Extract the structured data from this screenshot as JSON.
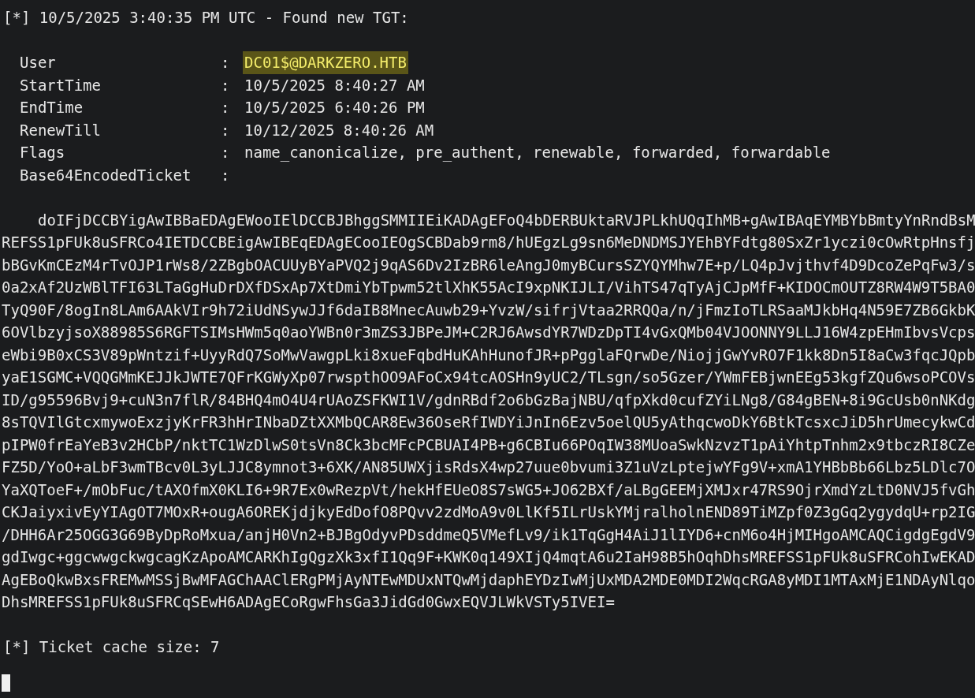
{
  "header": "[*] 10/5/2025 3:40:35 PM UTC - Found new TGT:",
  "fields": [
    {
      "key": "User",
      "separator": ":",
      "value": "DC01$@DARKZERO.HTB",
      "highlighted": true
    },
    {
      "key": "StartTime",
      "separator": ":",
      "value": "10/5/2025 8:40:27 AM",
      "highlighted": false
    },
    {
      "key": "EndTime",
      "separator": ":",
      "value": "10/5/2025 6:40:26 PM",
      "highlighted": false
    },
    {
      "key": "RenewTill",
      "separator": ":",
      "value": "10/12/2025 8:40:26 AM",
      "highlighted": false
    },
    {
      "key": "Flags",
      "separator": ":",
      "value": "name_canonicalize, pre_authent, renewable, forwarded, forwardable",
      "highlighted": false
    },
    {
      "key": "Base64EncodedTicket",
      "separator": ":"
    }
  ],
  "ticket_lines": [
    "doIFjDCCBYigAwIBBaEDAgEWooIElDCCBJBhggSMMIIEiKADAgEFoQ4bDERBUktaRVJPLkhUQqIhMB+gAwIBAqEYMBYbBmtyYnRndBsM",
    "REFSS1pFUk8uSFRCo4IETDCCBEigAwIBEqEDAgECooIEOgSCBDab9rm8/hUEgzLg9sn6MeDNDMSJYEhBYFdtg80SxZr1yczi0cOwRtpHnsfj",
    "bBGvKmCEzM4rTvOJP1rWs8/2ZBgbOACUUyBYaPVQ2j9qAS6Dv2IzBR6leAngJ0myBCursSZYQYMhw7E+p/LQ4pJvjthvf4D9DcoZePqFw3/s",
    "0a2xAf2UzWBlTFI63LTaGgHuDrDXfDSxAp7XtDmiYbTpwm52tlXhK55AcI9xpNKIJLI/VihTS47qTyAjCJpMfF+KIDOCmOUTZ8RW4W9T5BA0",
    "TyQ90F/8ogIn8LAm6AAkVIr9h72iUdNSywJJf6daIB8MnecAuwb29+YvzW/sifrjVtaa2RRQQa/n/jFmzIoTLRSaaMJkbHq4N59E7ZB6GkbK",
    "6OVlbzyjsoX88985S6RGFTSIMsHWm5q0aoYWBn0r3mZS3JBPeJM+C2RJ6AwsdYR7WDzDpTI4vGxQMb04VJOONNY9LLJ16W4zpEHmIbvsVcps",
    "eWbi9B0xCS3V89pWntzif+UyyRdQ7SoMwVawgpLki8xueFqbdHuKAhHunofJR+pPgglaFQrwDe/NiojjGwYvRO7F1kk8Dn5I8aCw3fqcJQpb",
    "yaE1SGMC+VQQGMmKEJJkJWTE7QFrKGWyXp07rwspthOO9AFoCx94tcAOSHn9yUC2/TLsgn/so5Gzer/YWmFEBjwnEEg53kgfZQu6wsoPCOVs",
    "ID/g95596Bvj9+cuN3n7flR/84BHQ4mO4U4rUAoZSFKWI1V/gdnRBdf2o6bGzBajNBU/qfpXkd0cufZYiLNg8/G84gBEN+8i9GcUsb0nNKdg",
    "8sTQVIlGtcxmywoExzjyKrFR3hHrINbaDZtXXMbQCAR8Ew36OseRfIWDYiJnIn6Ezv5oelQU5yAthqcwoDkY6BtkTcsxcJiD5hrUmecykwCd",
    "pIPW0frEaYeB3v2HCbP/nktTC1WzDlwS0tsVn8Ck3bcMFcPCBUAI4PB+g6CBIu66POqIW38MUoaSwkNzvzT1pAiYhtpTnhm2x9tbczRI8CZe",
    "FZ5D/YoO+aLbF3wmTBcv0L3yLJJC8ymnot3+6XK/AN85UWXjisRdsX4wp27uue0bvumi3Z1uVzLptejwYFg9V+xmA1YHBbBb66Lbz5LDlc7O",
    "YaXQToeF+/mObFuc/tAXOfmX0KLI6+9R7Ex0wRezpVt/hekHfEUeO8S7sWG5+JO62BXf/aLBgGEEMjXMJxr47RS9OjrXmdYzLtD0NVJ5fvGh",
    "CKJaiyxivEyYIAgOT7MOxR+ougA6OREKjdjkyEdDofO8PQvv2zdMoA9v0LlKf5ILrUskYMjralholnEND89TiMZpf0Z3gGq2ygydqU+rp2IG",
    "/DHH6Ar25OGG3G69ByDpRoMxua/anjH0Vn2+BJBgOdyvPDsddmeQ5VMefLv9/ik1TqGgH4AiJ1lIYD6+cnM6o4HjMIHgoAMCAQCigdgEgdV9",
    "gdIwgc+ggcwwgckwgcagKzApoAMCARKhIgQgzXk3xfI1Qq9F+KWK0q149XIjQ4mqtA6u2IaH98B5hOqhDhsMREFSS1pFUk8uSFRCohIwEKAD",
    "AgEBoQkwBxsFREMwMSSjBwMFAGChAAClERgPMjAyNTEwMDUxNTQwMjdaphEYDzIwMjUxMDA2MDE0MDI2WqcRGA8yMDI1MTAxMjE1NDAyNlqo",
    "DhsMREFSS1pFUk8uSFRCqSEwH6ADAgECoRgwFhsGa3JidGd0GwxEQVJLWkVSTy5IVEI="
  ],
  "footer": "[*] Ticket cache size: 7"
}
